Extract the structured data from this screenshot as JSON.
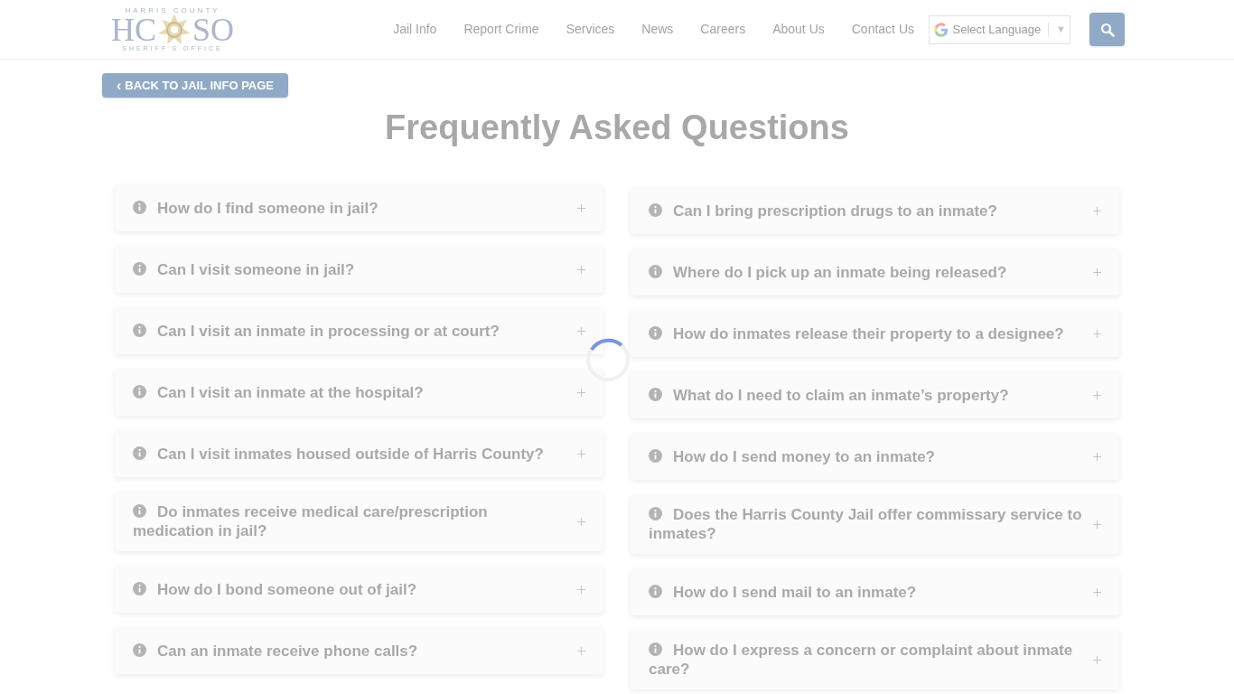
{
  "logo": {
    "top": "HARRIS COUNTY",
    "left": "HC",
    "right": "SO",
    "bottom": "SHERIFF'S OFFICE"
  },
  "nav": [
    "Jail Info",
    "Report Crime",
    "Services",
    "News",
    "Careers",
    "About Us",
    "Contact Us"
  ],
  "language": {
    "label": "Select Language",
    "arrow": "▼"
  },
  "back_button": {
    "arrow": "‹",
    "label": "BACK TO JAIL INFO PAGE"
  },
  "title": "Frequently Asked Questions",
  "loading": true,
  "faq_left": [
    {
      "question": "How do I find someone in jail?",
      "expanded": false
    },
    {
      "question": "Can I visit someone in jail?",
      "expanded": false
    },
    {
      "question": "Can I visit an inmate in processing or at court?",
      "expanded": false
    },
    {
      "question": "Can I visit an inmate at the hospital?",
      "expanded": false
    },
    {
      "question": "Can I visit inmates housed outside of Harris County?",
      "expanded": false
    },
    {
      "question": "Do inmates receive medical care/prescription medication in jail?",
      "expanded": false
    },
    {
      "question": "How do I bond someone out of jail?",
      "expanded": false
    },
    {
      "question": "Can an inmate receive phone calls?",
      "expanded": false
    }
  ],
  "faq_right": [
    {
      "question": "Can I bring prescription drugs to an inmate?",
      "expanded": false
    },
    {
      "question": "Where do I pick up an inmate being released?",
      "expanded": false
    },
    {
      "question": "How do inmates release their property to a designee?",
      "expanded": false
    },
    {
      "question": "What do I need to claim an inmate’s property?",
      "expanded": false
    },
    {
      "question": "How do I send money to an inmate?",
      "expanded": false
    },
    {
      "question": "Does the Harris County Jail offer commissary service to inmates?",
      "expanded": false
    },
    {
      "question": "How do I send mail to an inmate?",
      "expanded": false
    },
    {
      "question": "How do I express a concern or complaint about inmate care?",
      "expanded": false
    }
  ]
}
